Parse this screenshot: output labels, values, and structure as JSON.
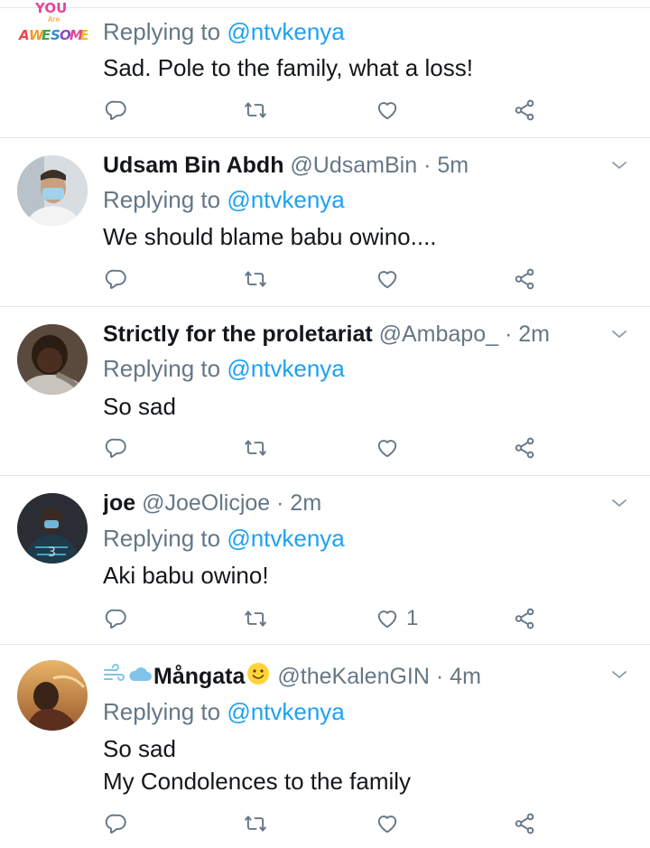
{
  "tweets": [
    {
      "name": "",
      "handle": "",
      "time": "",
      "replying_prefix": "Replying to ",
      "replying_to": "@ntvkenya",
      "text": "Sad. Pole to the family, what a loss!",
      "likes": "",
      "avatar_icon": "you-are-awesome-logo"
    },
    {
      "name": "Udsam Bin Abdh",
      "handle": "@UdsamBin",
      "dot": "·",
      "time": "5m",
      "replying_prefix": "Replying to ",
      "replying_to": "@ntvkenya",
      "text": "We should blame babu owino....",
      "likes": ""
    },
    {
      "name": "Strictly for the proletariat",
      "handle": "@Ambapo_",
      "dot": "·",
      "time": "2m",
      "replying_prefix": "Replying to ",
      "replying_to": "@ntvkenya",
      "text": "So sad",
      "likes": ""
    },
    {
      "name": "joe",
      "handle": "@JoeOlicjoe",
      "dot": "·",
      "time": "2m",
      "replying_prefix": "Replying to ",
      "replying_to": "@ntvkenya",
      "text": "Aki babu owino!",
      "likes": "1"
    },
    {
      "name": "Mångata",
      "handle": "@theKalenGIN",
      "dot": "·",
      "time": "4m",
      "replying_prefix": "Replying to ",
      "replying_to": "@ntvkenya",
      "text": "So sad\nMy Condolences to the family",
      "likes": ""
    }
  ],
  "colors": {
    "link": "#1da1f2",
    "muted": "#657786",
    "divider": "#e1e8ed",
    "icon": "#657786"
  },
  "icons": {
    "reply": "reply-icon",
    "retweet": "retweet-icon",
    "like": "heart-icon",
    "share": "share-icon",
    "caret": "chevron-down-icon"
  }
}
